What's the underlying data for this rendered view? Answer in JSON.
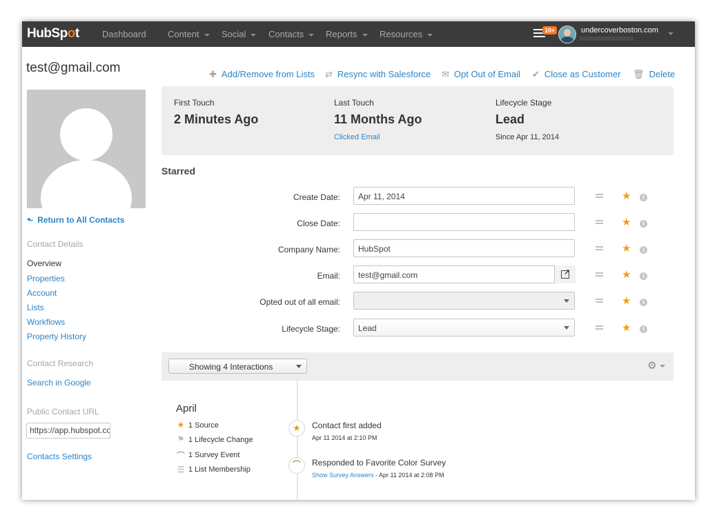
{
  "nav": {
    "logo_left": "HubSp",
    "logo_o": "o",
    "logo_right": "t",
    "items": [
      "Dashboard",
      "Content",
      "Social",
      "Contacts",
      "Reports",
      "Resources"
    ],
    "notif_badge": "10+",
    "account": "undercoverboston.com"
  },
  "contact": {
    "title": "test@gmail.com",
    "return_link": "Return to All Contacts"
  },
  "sidebar": {
    "details_label": "Contact Details",
    "overview": "Overview",
    "links": [
      "Properties",
      "Account",
      "Lists",
      "Workflows",
      "Property History"
    ],
    "research_label": "Contact Research",
    "search_google": "Search in Google",
    "public_url_label": "Public Contact URL",
    "public_url_value": "https://app.hubspot.com",
    "settings": "Contacts Settings"
  },
  "actions": {
    "add_remove": "Add/Remove from Lists",
    "resync": "Resync with Salesforce",
    "opt_out": "Opt Out of Email",
    "close_customer": "Close as Customer",
    "delete": "Delete"
  },
  "summary": {
    "first_touch_label": "First Touch",
    "first_touch_value": "2 Minutes Ago",
    "last_touch_label": "Last Touch",
    "last_touch_value": "11 Months Ago",
    "last_touch_sub": "Clicked Email",
    "stage_label": "Lifecycle Stage",
    "stage_value": "Lead",
    "stage_sub": "Since Apr 11, 2014"
  },
  "starred": {
    "title": "Starred",
    "fields": [
      {
        "label": "Create Date:",
        "value": "Apr 11, 2014"
      },
      {
        "label": "Close Date:",
        "value": ""
      },
      {
        "label": "Company Name:",
        "value": "HubSpot"
      },
      {
        "label": "Email:",
        "value": "test@gmail.com"
      },
      {
        "label": "Opted out of all email:",
        "value": ""
      },
      {
        "label": "Lifecycle Stage:",
        "value": "Lead"
      }
    ]
  },
  "interactions": {
    "filter": "Showing 4 Interactions",
    "month": "April",
    "summary": [
      {
        "icon": "star-icon",
        "text": "1 Source"
      },
      {
        "icon": "flag-icon",
        "text": "1 Lifecycle Change"
      },
      {
        "icon": "survey-icon",
        "text": "1 Survey Event"
      },
      {
        "icon": "list-icon",
        "text": "1 List Membership"
      }
    ],
    "events": [
      {
        "title": "Contact first added",
        "sub": "Apr 11 2014 at 2:10 PM"
      },
      {
        "title": "Responded to Favorite Color Survey",
        "link": "Show Survey Answers",
        "sub": " - Apr 11 2014 at 2:08 PM"
      }
    ]
  },
  "colors": {
    "accent": "#2d84c6",
    "brand_orange": "#f57722",
    "star": "#f39c12",
    "nav_bg": "#3b3b3b"
  }
}
